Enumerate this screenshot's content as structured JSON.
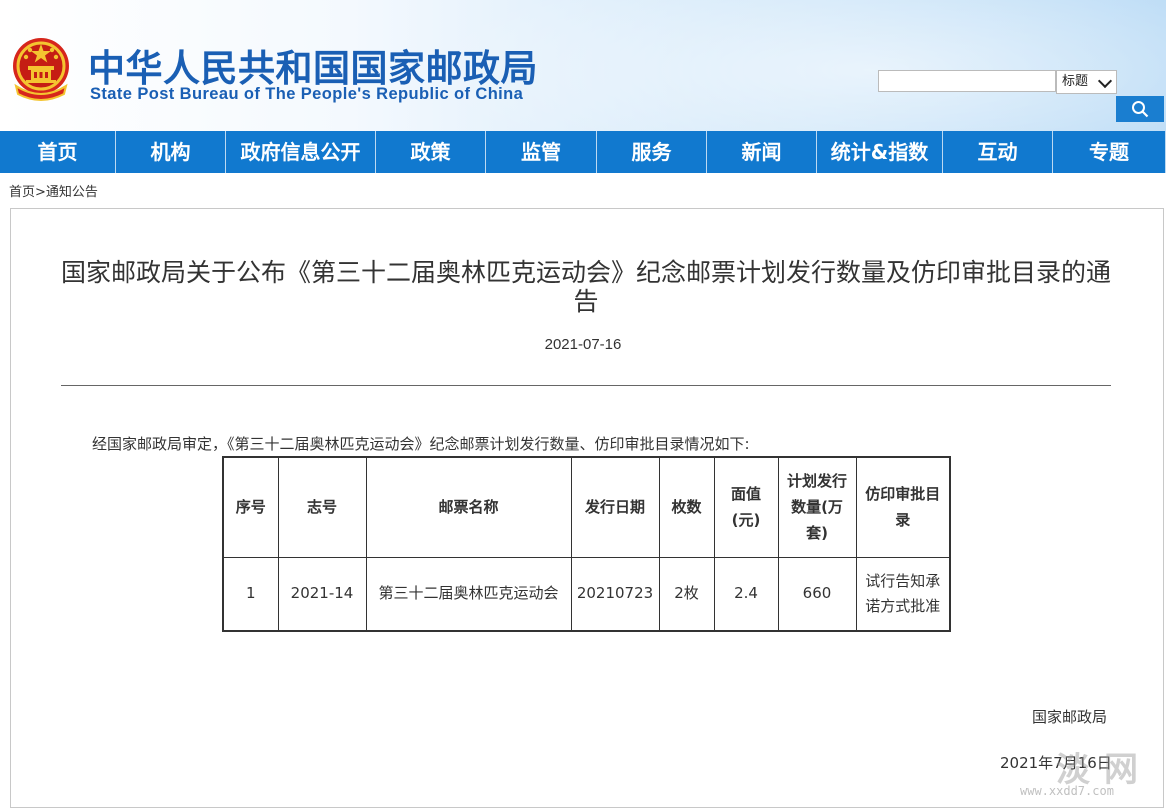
{
  "header": {
    "title_cn": "中华人民共和国国家邮政局",
    "title_en": "State Post Bureau of The People's Republic of China",
    "search": {
      "placeholder": "",
      "select_value": "标题"
    }
  },
  "nav": {
    "items": [
      "首页",
      "机构",
      "政府信息公开",
      "政策",
      "监管",
      "服务",
      "新闻",
      "统计&指数",
      "互动",
      "专题"
    ]
  },
  "breadcrumb": {
    "home": "首页",
    "sep": ">",
    "current": "通知公告"
  },
  "article": {
    "title": "国家邮政局关于公布《第三十二届奥林匹克运动会》纪念邮票计划发行数量及仿印审批目录的通告",
    "date": "2021-07-16",
    "intro": "经国家邮政局审定，《第三十二届奥林匹克运动会》纪念邮票计划发行数量、仿印审批目录情况如下:",
    "table": {
      "headers": [
        "序号",
        "志号",
        "邮票名称",
        "发行日期",
        "枚数",
        "面值(元)",
        "计划发行数量(万套)",
        "仿印审批目录"
      ],
      "rows": [
        [
          "1",
          "2021-14",
          "第三十二届奥林匹克运动会",
          "20210723",
          "2枚",
          "2.4",
          "660",
          "试行告知承诺方式批准"
        ]
      ]
    },
    "signer": "国家邮政局",
    "sign_date": "2021年7月16日"
  },
  "watermark": {
    "cn": "淡网",
    "en": "www.xxdd7.com"
  },
  "colors": {
    "nav_bg": "#1179cf",
    "title_blue": "#1a5fb4",
    "search_btn": "#1a7ed0"
  },
  "icons": {
    "emblem": "national-emblem-icon",
    "search": "search-icon",
    "dropdown": "chevron-down-icon"
  }
}
